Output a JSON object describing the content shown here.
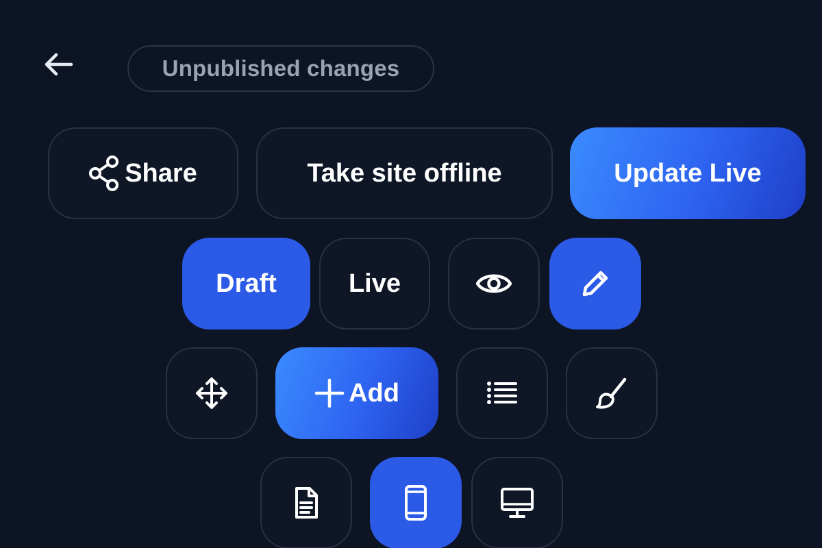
{
  "header": {
    "back_icon": "arrow-left-icon",
    "status_badge": "Unpublished changes"
  },
  "actions": {
    "share_label": "Share",
    "share_icon": "share-icon",
    "offline_label": "Take site offline",
    "update_label": "Update Live"
  },
  "mode_toggle": {
    "draft_label": "Draft",
    "live_label": "Live",
    "selected": "Draft"
  },
  "view_toggle": {
    "preview_icon": "eye-icon",
    "edit_icon": "pencil-icon",
    "selected": "edit"
  },
  "tools": {
    "move_icon": "move-arrows-icon",
    "add_label": "Add",
    "add_icon": "plus-icon",
    "list_icon": "list-icon",
    "style_icon": "brush-icon"
  },
  "devices": {
    "page_icon": "document-icon",
    "mobile_icon": "mobile-icon",
    "desktop_icon": "desktop-icon",
    "selected": "mobile"
  },
  "colors": {
    "background": "#0d1424",
    "accent": "#2b5ae6",
    "gradient_start": "#3b8bff",
    "gradient_end": "#1f3fc7",
    "border": "#283144",
    "muted_text": "#9aa3b2"
  }
}
